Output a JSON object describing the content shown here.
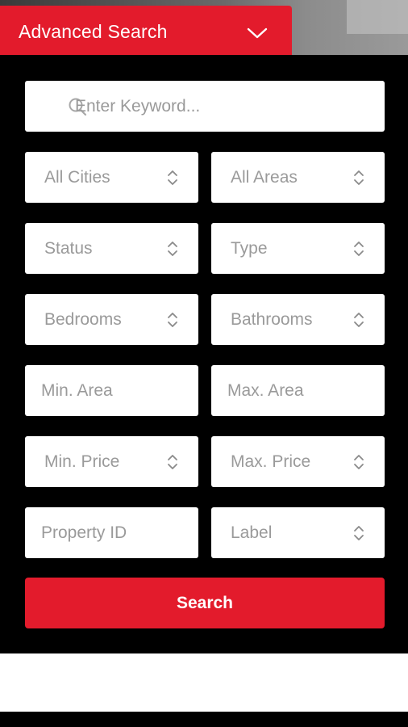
{
  "tab": {
    "label": "Advanced Search",
    "icon": "chevron-down-icon"
  },
  "keyword": {
    "placeholder": "Enter Keyword...",
    "icon": "search-icon"
  },
  "selects": {
    "city": "All Cities",
    "area": "All Areas",
    "status": "Status",
    "type": "Type",
    "bedrooms": "Bedrooms",
    "bathrooms": "Bathrooms",
    "min_price": "Min. Price",
    "max_price": "Max. Price",
    "label": "Label"
  },
  "inputs": {
    "min_area": "Min. Area",
    "max_area": "Max. Area",
    "property_id": "Property ID"
  },
  "search_button": "Search",
  "colors": {
    "accent": "#e31b2c",
    "field": "#ffffff",
    "placeholder": "#9a9a9a",
    "background": "#000000"
  }
}
